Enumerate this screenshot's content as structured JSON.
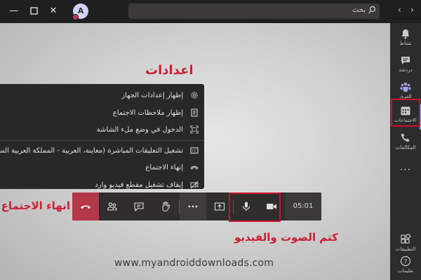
{
  "titlebar": {
    "avatar_initial": "A",
    "search_placeholder": "بحث",
    "min_icon": "minimize-icon",
    "max_icon": "maximize-icon",
    "close_icon": "close-icon"
  },
  "rail": {
    "items": [
      {
        "label": "نشاط",
        "icon": "bell-icon"
      },
      {
        "label": "دردشة",
        "icon": "chat-icon"
      },
      {
        "label": "الفرق",
        "icon": "teams-icon"
      },
      {
        "label": "الاجتماعات",
        "icon": "calendar-icon",
        "active": true
      },
      {
        "label": "المكالمات",
        "icon": "phone-icon"
      },
      {
        "label": "...",
        "icon": "more-icon"
      },
      {
        "label": "التطبيقات",
        "icon": "apps-icon"
      },
      {
        "label": "تعليمات",
        "icon": "help-icon"
      }
    ]
  },
  "annotations": {
    "settings": "اعدادات",
    "end_meeting": "انهاء الاجتماع",
    "mute": "كتم الصوت والفيديو"
  },
  "watermark": "www.myandroiddownloads.com",
  "menu": {
    "items": [
      {
        "label": "إظهار إعدادات الجهاز",
        "icon": "gear-icon"
      },
      {
        "label": "إظهار ملاحظات الاجتماع",
        "icon": "notes-icon"
      },
      {
        "label": "الدخول في وضع ملء الشاشة",
        "icon": "fullscreen-icon"
      },
      {
        "label": "تشغيل التعليقات المباشرة (معاينة، العربية - المملكة العربية السعودية فقط)",
        "icon": "captions-icon"
      },
      {
        "label": "إنهاء الاجتماع",
        "icon": "end-meeting-icon"
      },
      {
        "label": "إيقاف تشغيل مقطع فيديو وارد",
        "icon": "video-off-icon"
      }
    ]
  },
  "callbar": {
    "timer": "05:01"
  },
  "colors": {
    "accent": "#a5a6f6",
    "annotation_red": "#cc1f37",
    "hangup": "#b4374a"
  }
}
